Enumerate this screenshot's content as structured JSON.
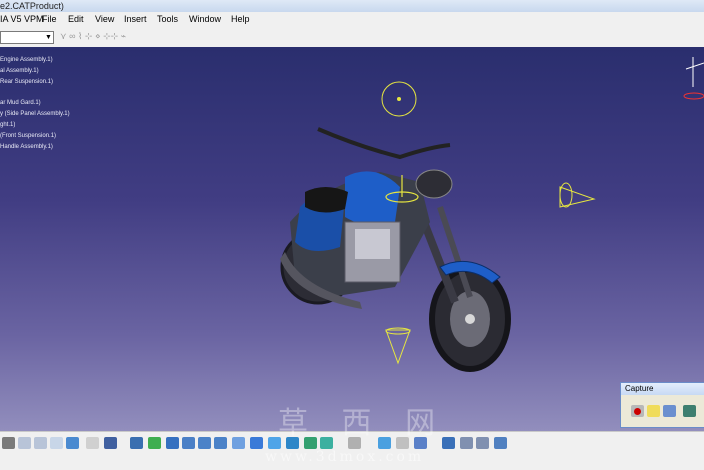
{
  "window": {
    "title": "e2.CATProduct)"
  },
  "menu": {
    "app_label": "IA V5 VPM",
    "items": [
      "File",
      "Edit",
      "View",
      "Insert",
      "Tools",
      "Window",
      "Help"
    ]
  },
  "tree": {
    "items": [
      "Engine Assembly.1)",
      "al Assembly.1)",
      "Rear Suspension.1)",
      "ar Mud Gard.1)",
      "y (Side Panel Assembly.1)",
      "ght.1)",
      "(Front Suspension.1)",
      "Handle Assembly.1)"
    ]
  },
  "capture_panel": {
    "title": "Capture"
  },
  "watermark": {
    "cn": "草 西 网",
    "url": "www.3dmox.com"
  },
  "colors": {
    "bg_top": "#2a2e6e",
    "bg_bottom": "#928ebd",
    "bike_accent": "#1e5ec8",
    "compass": "#e6e640"
  }
}
